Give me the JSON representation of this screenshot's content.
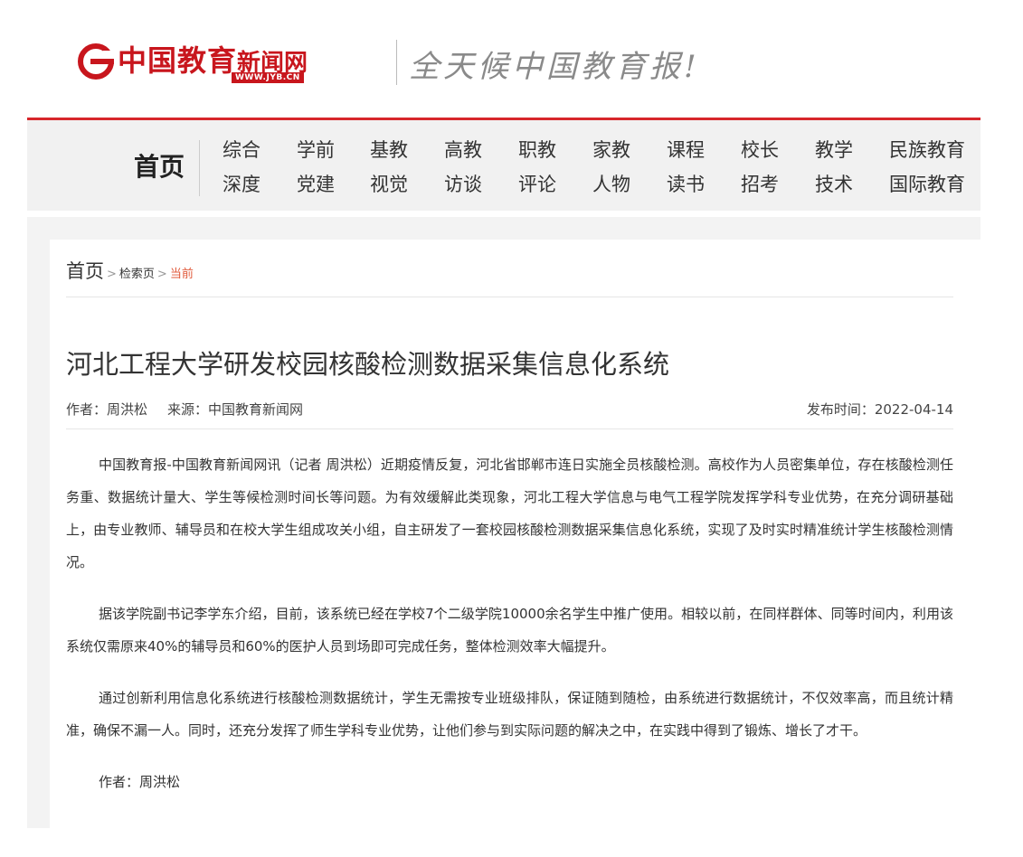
{
  "header": {
    "logo_name": "中国教育",
    "logo_name_suffix": "新闻网",
    "logo_url": "WWW.JYB.CN",
    "slogan": "全天候中国教育报!"
  },
  "nav": {
    "home": "首页",
    "rows": [
      [
        "综合",
        "学前",
        "基教",
        "高教",
        "职教",
        "家教",
        "课程",
        "校长",
        "教学",
        "民族教育"
      ],
      [
        "深度",
        "党建",
        "视觉",
        "访谈",
        "评论",
        "人物",
        "读书",
        "招考",
        "技术",
        "国际教育"
      ]
    ]
  },
  "breadcrumb": {
    "home": "首页",
    "search": "检索页",
    "current": "当前"
  },
  "article": {
    "title": "河北工程大学研发校园核酸检测数据采集信息化系统",
    "author": "作者：周洪松",
    "source": "来源：中国教育新闻网",
    "publish_time": "发布时间：2022-04-14",
    "paragraphs": [
      "中国教育报-中国教育新闻网讯（记者 周洪松）近期疫情反复，河北省邯郸市连日实施全员核酸检测。高校作为人员密集单位，存在核酸检测任务重、数据统计量大、学生等候检测时间长等问题。为有效缓解此类现象，河北工程大学信息与电气工程学院发挥学科专业优势，在充分调研基础上，由专业教师、辅导员和在校大学生组成攻关小组，自主研发了一套校园核酸检测数据采集信息化系统，实现了及时实时精准统计学生核酸检测情况。",
      "据该学院副书记李学东介绍，目前，该系统已经在学校7个二级学院10000余名学生中推广使用。相较以前，在同样群体、同等时间内，利用该系统仅需原来40%的辅导员和60%的医护人员到场即可完成任务，整体检测效率大幅提升。",
      "通过创新利用信息化系统进行核酸检测数据统计，学生无需按专业班级排队，保证随到随检，由系统进行数据统计，不仅效率高，而且统计精准，确保不漏一人。同时，还充分发挥了师生学科专业优势，让他们参与到实际问题的解决之中，在实践中得到了锻炼、增长了才干。",
      "作者：周洪松"
    ]
  }
}
